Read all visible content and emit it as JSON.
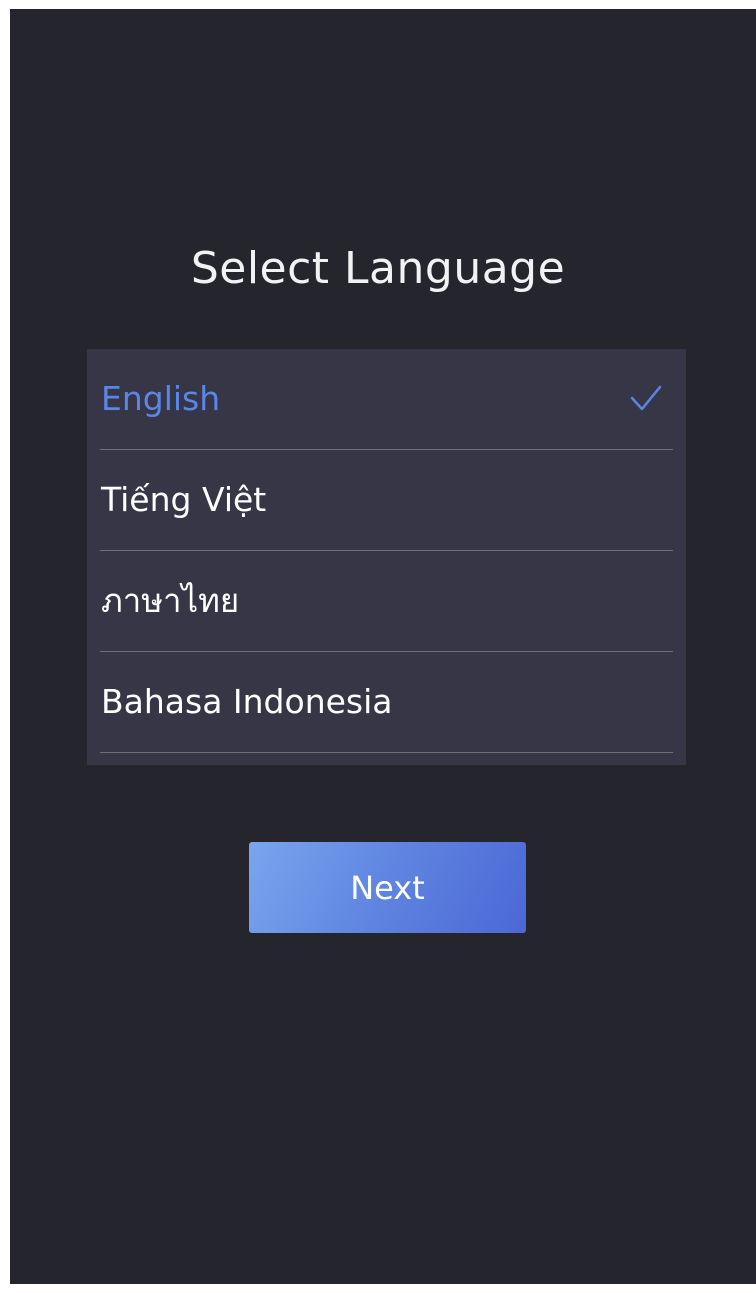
{
  "page": {
    "title": "Select Language"
  },
  "languages": [
    {
      "label": "English",
      "selected": true
    },
    {
      "label": "Tiếng Việt",
      "selected": false
    },
    {
      "label": "ภาษาไทย",
      "selected": false
    },
    {
      "label": "Bahasa Indonesia",
      "selected": false
    }
  ],
  "actions": {
    "next_label": "Next"
  },
  "icons": {
    "selected_indicator": "checkmark-icon"
  },
  "colors": {
    "background": "#25252e",
    "list_background": "#363646",
    "accent": "#5b86e6",
    "divider": "#6e6e7c",
    "button_gradient_start": "#7aa5ee",
    "button_gradient_end": "#4c67d6"
  }
}
